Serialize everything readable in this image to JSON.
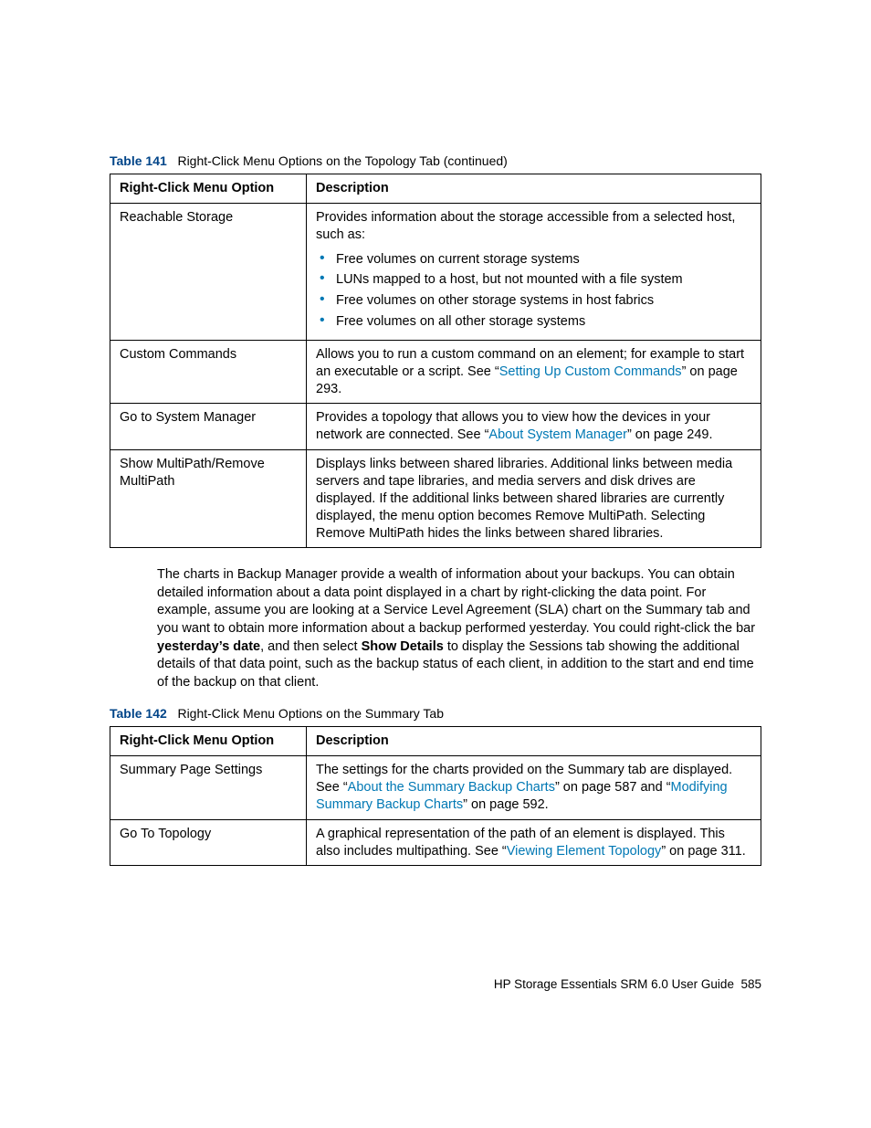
{
  "table141": {
    "label": "Table 141",
    "caption": "Right-Click Menu Options on the Topology Tab (continued)",
    "headers": {
      "c1": "Right-Click Menu Option",
      "c2": "Description"
    },
    "rows": {
      "r1": {
        "c1": "Reachable Storage",
        "c2_intro": "Provides information about the storage accessible from a selected host, such as:",
        "b1": "Free volumes on current storage systems",
        "b2": "LUNs mapped to a host, but not mounted with a file system",
        "b3": "Free volumes on other storage systems in host fabrics",
        "b4": "Free volumes on all other storage systems"
      },
      "r2": {
        "c1": "Custom Commands",
        "c2a": "Allows you to run a custom command on an element; for example to start an executable or a script. See “",
        "link": "Setting Up Custom Commands",
        "c2b": "” on page 293."
      },
      "r3": {
        "c1": "Go to System Manager",
        "c2a": "Provides a topology that allows you to view how the devices in your network are connected. See “",
        "link": "About System Manager",
        "c2b": "” on page 249."
      },
      "r4": {
        "c1": "Show MultiPath/Remove MultiPath",
        "c2": "Displays links between shared libraries. Additional links between media servers and tape libraries, and media servers and disk drives are displayed. If the additional links between shared libraries are currently displayed, the menu option becomes Remove MultiPath. Selecting Remove MultiPath hides the links between shared libraries."
      }
    }
  },
  "paragraph": {
    "p1": "The charts in Backup Manager provide a wealth of information about your backups. You can obtain detailed information about a data point displayed in a chart by right-clicking the data point. For example, assume you are looking at a Service Level Agreement (SLA) chart on the Summary tab and you want to obtain more information about a backup performed yesterday. You could right-click the bar ",
    "bold1": "yesterday’s date",
    "p2": ", and then select ",
    "bold2": "Show Details",
    "p3": " to display the Sessions tab showing the additional details of that data point, such as the backup status of each client, in addition to the start and end time of the backup on that client."
  },
  "table142": {
    "label": "Table 142",
    "caption": "Right-Click Menu Options on the Summary Tab",
    "headers": {
      "c1": "Right-Click Menu Option",
      "c2": "Description"
    },
    "rows": {
      "r1": {
        "c1": "Summary Page Settings",
        "c2a": "The settings for the charts provided on the Summary tab are displayed. See “",
        "link1": "About the Summary Backup Charts",
        "c2b": "” on page 587 and “",
        "link2": "Modifying Summary Backup Charts",
        "c2c": "” on page 592."
      },
      "r2": {
        "c1": "Go To Topology",
        "c2a": "A graphical representation of the path of an element is displayed. This also includes multipathing. See “",
        "link": "Viewing Element Topology",
        "c2b": "” on page 311."
      }
    }
  },
  "footer": {
    "text": "HP Storage Essentials SRM 6.0 User Guide",
    "page": "585"
  }
}
